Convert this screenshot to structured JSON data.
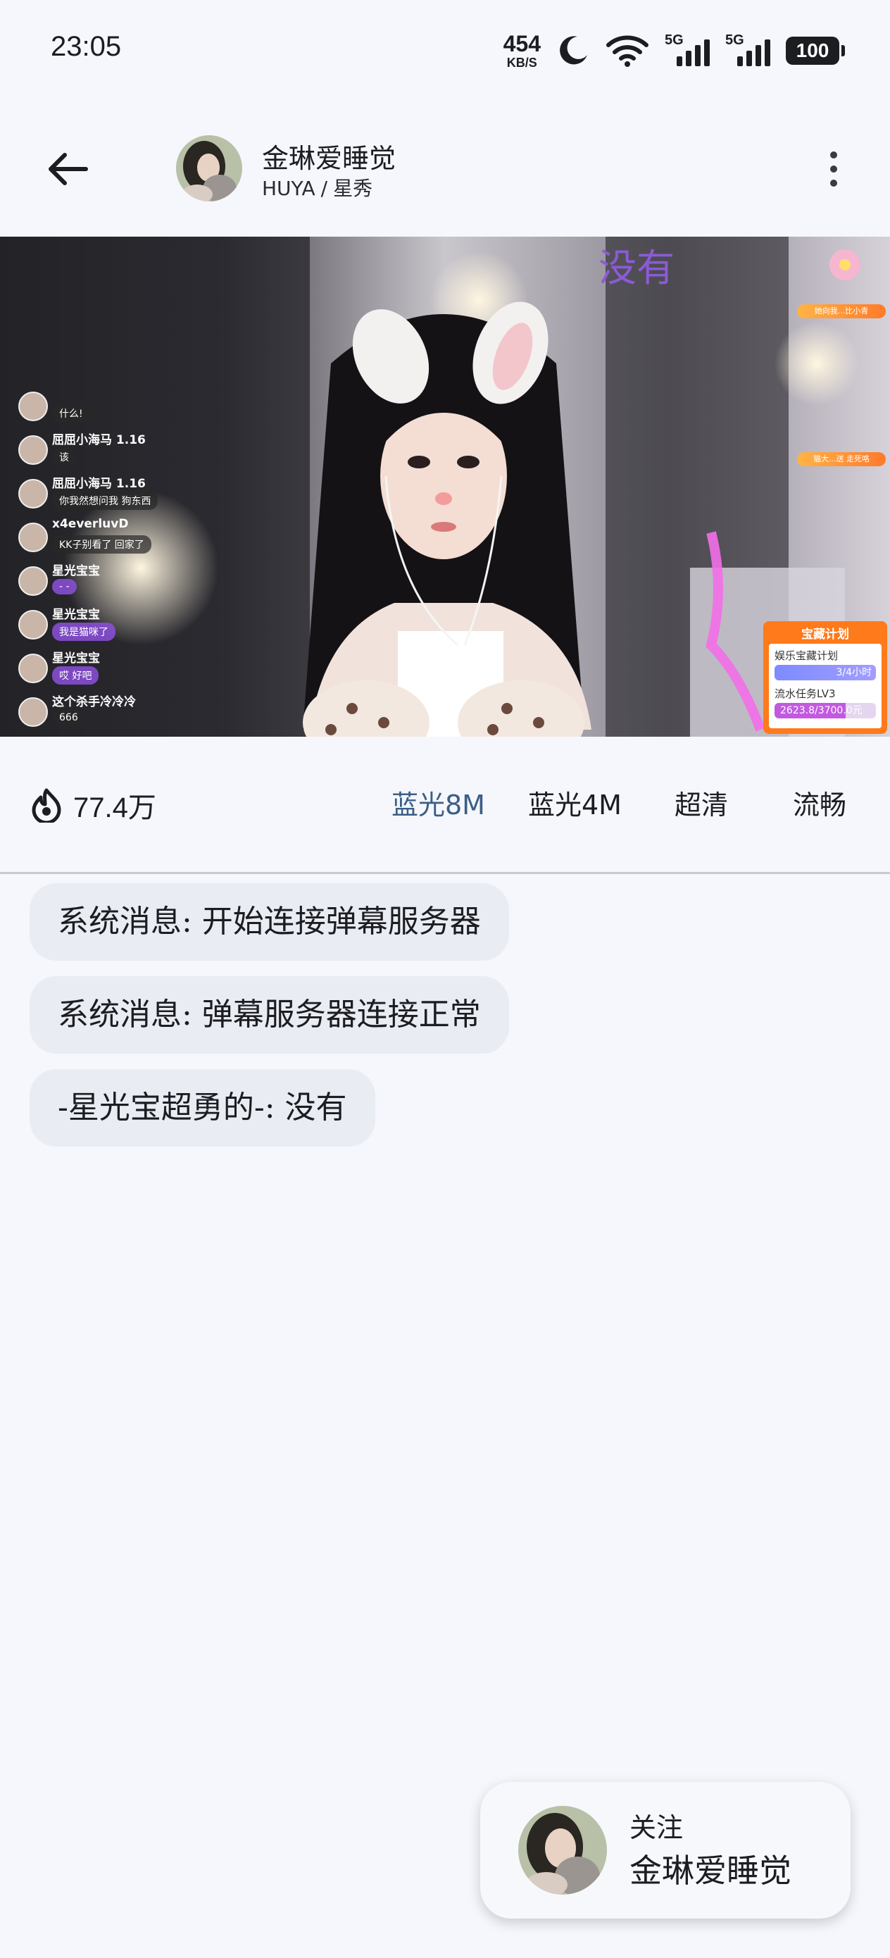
{
  "status": {
    "time": "23:05",
    "net_speed": "454",
    "net_unit": "KB/S",
    "signal1_label": "5G",
    "signal2_label": "5G",
    "battery": "100"
  },
  "header": {
    "streamer_name": "金琳爱睡觉",
    "platform": "HUYA",
    "separator": "/",
    "category": "星秀"
  },
  "video": {
    "overlay_text": "没有",
    "chat_overlay": [
      {
        "name": "",
        "message": "什么!"
      },
      {
        "name": "屈屈小海马 1.16",
        "message": "该"
      },
      {
        "name": "屈屈小海马 1.16",
        "message": "你我然想问我 狗东西"
      },
      {
        "name": "x4everluvD",
        "message": "KK子别看了 回家了"
      },
      {
        "name": "星光宝宝",
        "message": "- -"
      },
      {
        "name": "星光宝宝",
        "message": "我是猫咪了"
      },
      {
        "name": "星光宝宝",
        "message": "哎 好吧"
      },
      {
        "name": "这个杀手冷冷冷",
        "message": "666"
      }
    ],
    "gift_tags": [
      "她向我...比小青",
      "猫大...送 走死咯"
    ],
    "plan_card": {
      "title": "宝藏计划",
      "line1": "娱乐宝藏计划",
      "bar1": "3/4小时",
      "line2": "流水任务LV3",
      "bar2": "2623.8/3700.0元"
    }
  },
  "quality": {
    "viewers": "77.4万",
    "options": [
      "蓝光8M",
      "蓝光4M",
      "超清",
      "流畅"
    ],
    "active_index": 0
  },
  "messages": [
    "系统消息: 开始连接弹幕服务器",
    "系统消息: 弹幕服务器连接正常",
    "-星光宝超勇的-: 没有"
  ],
  "follow_card": {
    "label": "关注",
    "name": "金琳爱睡觉"
  },
  "colors": {
    "background": "#f5f7fd",
    "active_quality": "#3b5f86",
    "bubble": "#e9ecf3"
  }
}
